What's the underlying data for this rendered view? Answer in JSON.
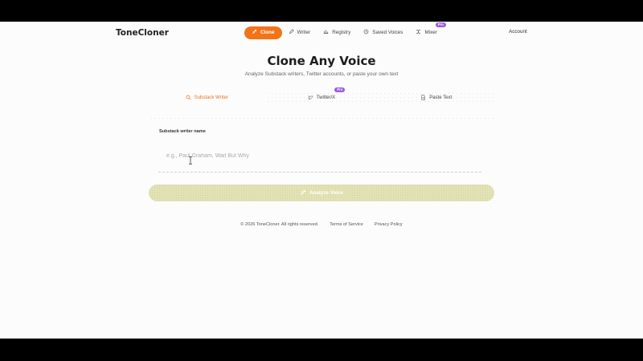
{
  "app": {
    "brand": "ToneCloner"
  },
  "nav": {
    "items": [
      {
        "label": "Clone",
        "icon": "clone-icon",
        "active": true
      },
      {
        "label": "Writer",
        "icon": "pen-icon"
      },
      {
        "label": "Registry",
        "icon": "registry-icon"
      },
      {
        "label": "Saved Voices",
        "icon": "history-icon"
      },
      {
        "label": "Mixer",
        "icon": "shuffle-icon",
        "badge": "Pro"
      }
    ],
    "account": "Account"
  },
  "hero": {
    "title": "Clone Any Voice",
    "subtitle": "Analyze Substack writers, Twitter accounts, or paste your own text"
  },
  "source_tabs": [
    {
      "label": "Substack Writer",
      "icon": "search-icon",
      "active": true
    },
    {
      "label": "Twitter/X",
      "icon": "twitter-icon",
      "badge": "Pro"
    },
    {
      "label": "Paste Text",
      "icon": "document-icon"
    }
  ],
  "form": {
    "label": "Substack writer name",
    "placeholder": "e.g., Paul Graham, Wait But Why",
    "value": "",
    "submit_label": "Analyze Voice"
  },
  "footer": {
    "copyright": "© 2026 ToneCloner. All rights reserved.",
    "links": [
      "Terms of Service",
      "Privacy Policy"
    ]
  },
  "colors": {
    "accent": "#f27318",
    "pro_badge": "#9a5ce6",
    "button_disabled": "#e2e2b6"
  }
}
